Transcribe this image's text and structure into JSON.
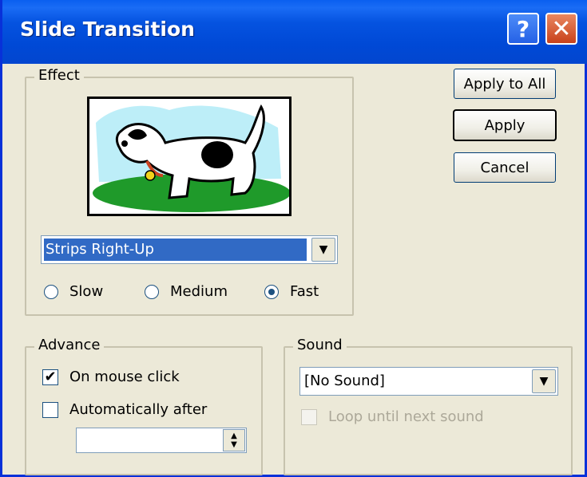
{
  "window": {
    "title": "Slide Transition",
    "help_label": "?",
    "close_label": "✕"
  },
  "effect": {
    "legend": "Effect",
    "transition": "Strips Right-Up",
    "speed_options": [
      "Slow",
      "Medium",
      "Fast"
    ],
    "selected_speed": "Fast"
  },
  "buttons": {
    "apply_all": "Apply to All",
    "apply": "Apply",
    "cancel": "Cancel"
  },
  "advance": {
    "legend": "Advance",
    "on_mouse_click": "On mouse click",
    "on_mouse_click_checked": true,
    "automatically_after": "Automatically after",
    "automatically_after_checked": false,
    "time_value": ""
  },
  "sound": {
    "legend": "Sound",
    "selected": "[No Sound]",
    "loop_label": "Loop until next sound",
    "loop_checked": false
  },
  "colors": {
    "titlebar": "#0553e0",
    "selection": "#316ac5",
    "face": "#ece9d8"
  }
}
